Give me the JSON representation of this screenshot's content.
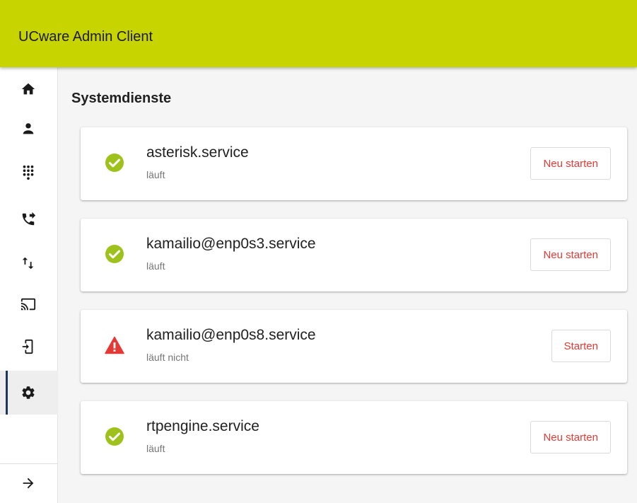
{
  "header": {
    "title": "UCware Admin Client"
  },
  "sidebar": {
    "items": [
      {
        "name": "sidebar-item-home",
        "icon": "home-icon",
        "active": false
      },
      {
        "name": "sidebar-item-users",
        "icon": "person-icon",
        "active": false
      },
      {
        "name": "sidebar-item-dialpad",
        "icon": "dialpad-icon",
        "active": false
      },
      {
        "name": "sidebar-item-call-forwarding",
        "icon": "phone-forward-icon",
        "active": false
      },
      {
        "name": "sidebar-item-routing",
        "icon": "swap-vert-icon",
        "active": false
      },
      {
        "name": "sidebar-item-provisioning",
        "icon": "cast-icon",
        "active": false
      },
      {
        "name": "sidebar-item-devices",
        "icon": "device-login-icon",
        "active": false
      },
      {
        "name": "sidebar-item-settings",
        "icon": "gear-icon",
        "active": true
      }
    ],
    "collapse_icon": "arrow-right-icon"
  },
  "main": {
    "title": "Systemdienste",
    "services": [
      {
        "name": "asterisk.service",
        "status": "läuft",
        "ok": true,
        "action": "Neu starten"
      },
      {
        "name": "kamailio@enp0s3.service",
        "status": "läuft",
        "ok": true,
        "action": "Neu starten"
      },
      {
        "name": "kamailio@enp0s8.service",
        "status": "läuft nicht",
        "ok": false,
        "action": "Starten"
      },
      {
        "name": "rtpengine.service",
        "status": "läuft",
        "ok": true,
        "action": "Neu starten"
      }
    ]
  },
  "colors": {
    "header": "#c8d400",
    "ok": "#9ec21b",
    "error": "#e53935",
    "action_text": "#e53935",
    "active_indicator": "#1c3a57"
  }
}
